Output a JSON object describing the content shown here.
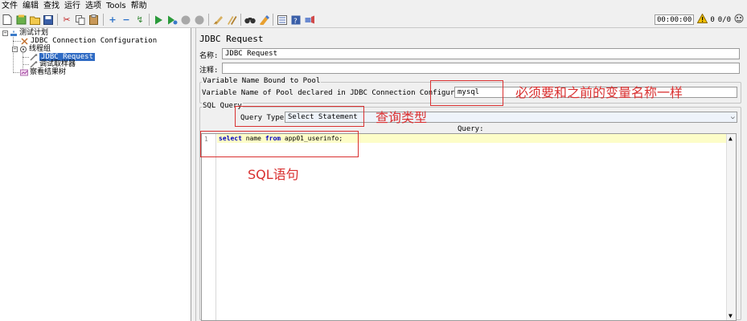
{
  "menu": {
    "items": [
      "文件",
      "编辑",
      "查找",
      "运行",
      "选项",
      "Tools",
      "帮助"
    ]
  },
  "toolbar": {
    "icons": [
      "new-file-icon",
      "templates-icon",
      "open-folder-icon",
      "save-icon",
      "cut-icon",
      "copy-icon",
      "paste-icon",
      "expand-icon",
      "collapse-icon",
      "toggle-icon",
      "start-icon",
      "start-no-pause-icon",
      "stop-icon",
      "shutdown-icon",
      "clear-icon",
      "clear-all-icon",
      "search-binoculars-icon",
      "reset-search-icon",
      "function-helper-icon",
      "help-icon",
      "remote-icon"
    ],
    "timer": "00:00:00",
    "warning_count": "0",
    "threads": "0/0"
  },
  "tree": {
    "nodes": [
      {
        "label": "测试计划",
        "icon": "test-plan-icon"
      },
      {
        "label": "JDBC Connection Configuration",
        "icon": "config-element-icon"
      },
      {
        "label": "线程组",
        "icon": "thread-group-icon"
      },
      {
        "label": "JDBC Request",
        "icon": "sampler-icon"
      },
      {
        "label": "调试取样器",
        "icon": "debug-sampler-icon"
      },
      {
        "label": "察看结果树",
        "icon": "listener-icon"
      }
    ]
  },
  "panel": {
    "title": "JDBC Request",
    "name_label": "名称:",
    "name_value": "JDBC Request",
    "comment_label": "注释:",
    "comment_value": "",
    "var_group_title": "Variable Name Bound to Pool",
    "var_label": "Variable Name of Pool declared in JDBC Connection Configuration:",
    "var_value": "mysql",
    "sql_group_title": "SQL Query",
    "query_type_label": "Query Type:",
    "query_type_value": "Select Statement",
    "query_header": "Query:",
    "line_number": "1",
    "sql_keyword_1": "select",
    "sql_text_1": " name ",
    "sql_keyword_2": "from",
    "sql_text_2": " app01_userinfo;"
  },
  "annotations": {
    "pool_note": "必须要和之前的变量名称一样",
    "query_type_note": "查询类型",
    "sql_note": "SQL语句",
    "color": "#d93030"
  }
}
